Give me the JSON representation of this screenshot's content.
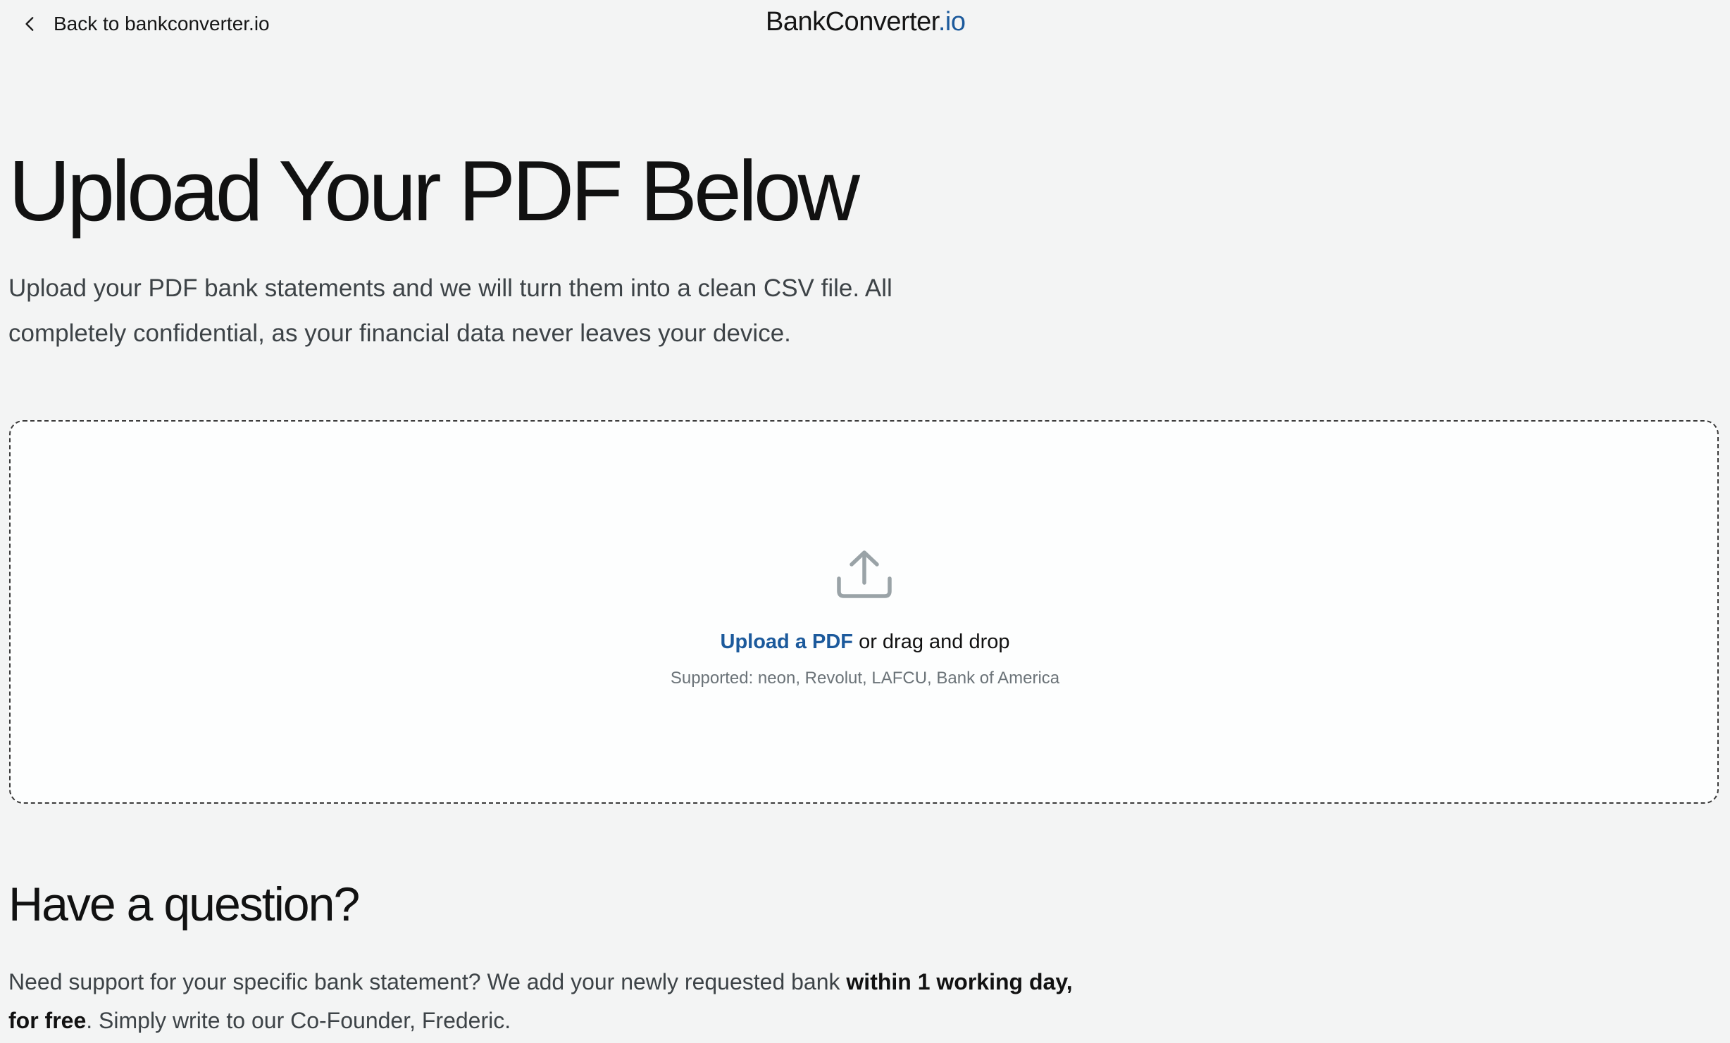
{
  "header": {
    "back_label": "Back to bankconverter.io",
    "brand_name": "BankConverter",
    "brand_tld": ".io",
    "brand_accent_color": "#1c5a9c"
  },
  "hero": {
    "title": "Upload Your PDF Below",
    "description": "Upload your PDF bank statements and we will turn them into a clean CSV file. All completely confidential, as your financial data never leaves your device."
  },
  "upload": {
    "icon": "upload-tray-icon",
    "link_label": "Upload a PDF",
    "drag_text": " or drag and drop",
    "supported_text": "Supported: neon, Revolut, LAFCU, Bank of America"
  },
  "question": {
    "title": "Have a question?",
    "text_before": "Need support for your specific bank statement? We add your newly requested bank ",
    "text_bold": "within 1 working day, for free",
    "text_after": ". Simply write to our Co-Founder, Frederic."
  }
}
